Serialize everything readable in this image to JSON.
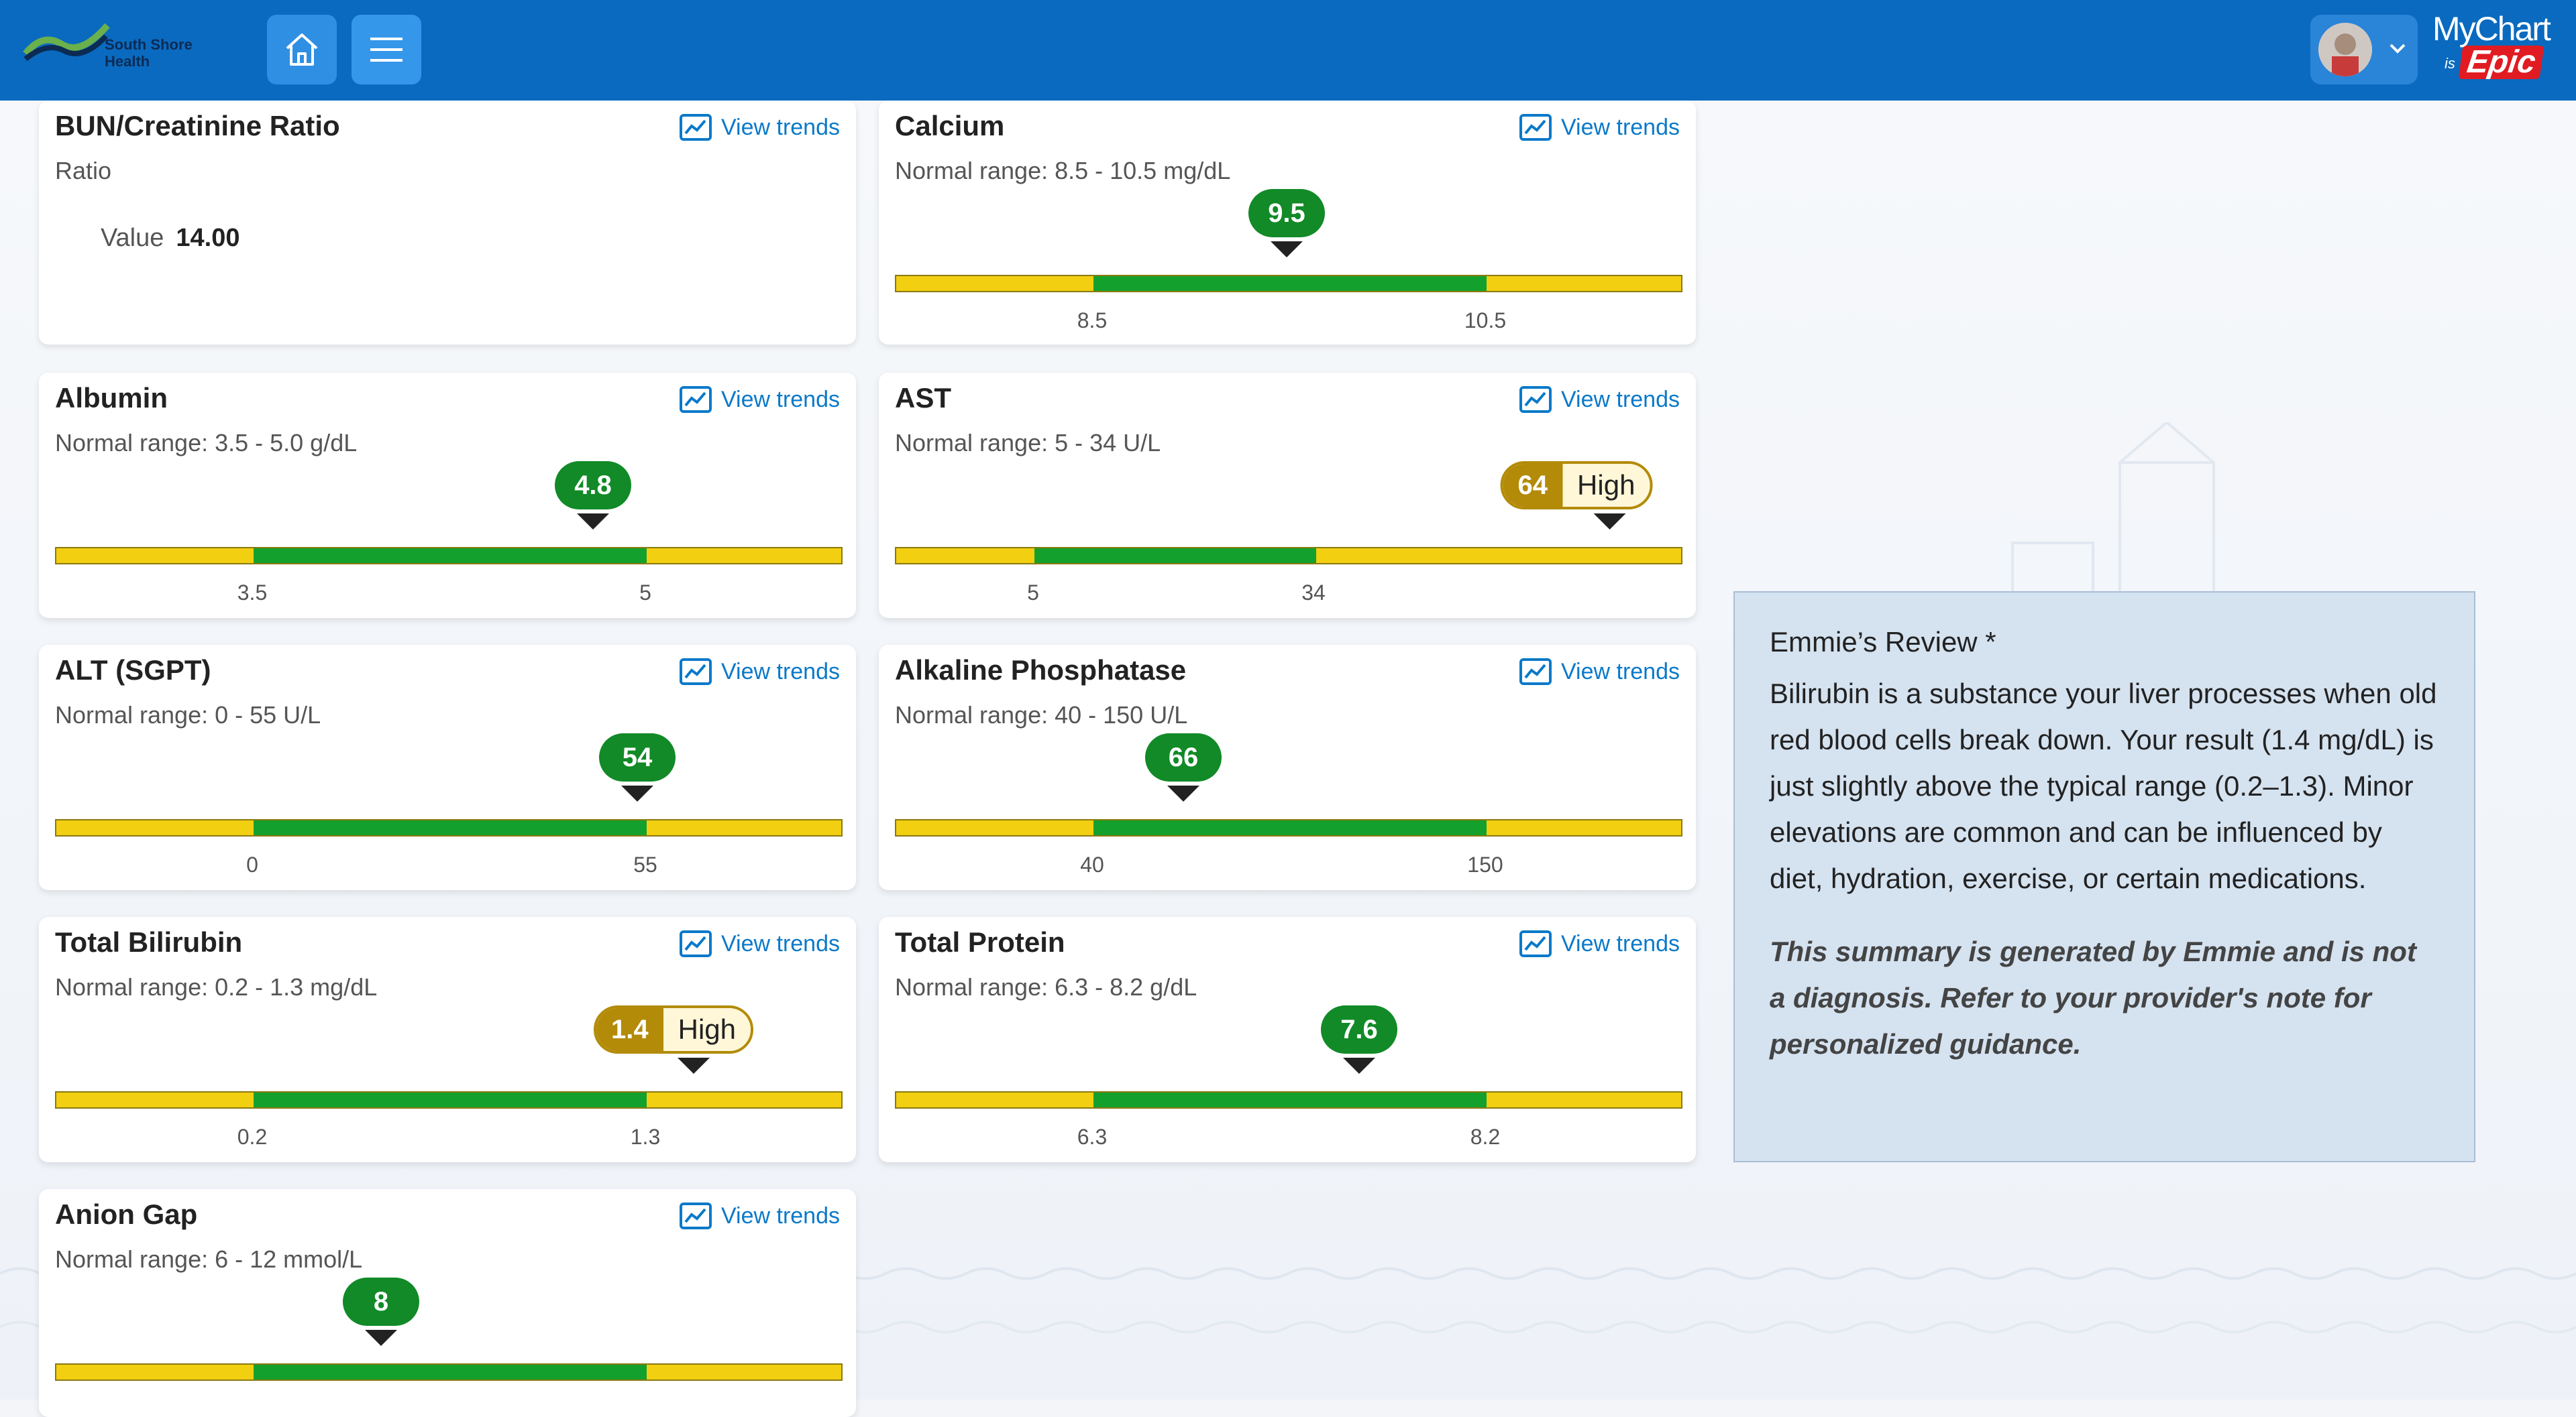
{
  "header": {
    "logo_text": [
      "South Shore",
      "Health"
    ],
    "brand": {
      "mychart": "MyChart",
      "is": "is",
      "epic": "Epic"
    }
  },
  "cards": [
    {
      "title": "BUN/Creatinine Ratio",
      "subtitle": "Ratio",
      "value_label": "Value",
      "value": "14.00",
      "trends": "View trends"
    },
    {
      "title": "Calcium",
      "subtitle": "Normal range: 8.5 - 10.5 mg/dL",
      "trends": "View trends",
      "result": "9.5",
      "low_label": "8.5",
      "high_label": "10.5"
    },
    {
      "title": "Albumin",
      "subtitle": "Normal range: 3.5 - 5.0 g/dL",
      "trends": "View trends",
      "result": "4.8",
      "low_label": "3.5",
      "high_label": "5"
    },
    {
      "title": "AST",
      "subtitle": "Normal range: 5 - 34 U/L",
      "trends": "View trends",
      "result": "64",
      "flag": "High",
      "low_label": "5",
      "high_label": "34"
    },
    {
      "title": "ALT (SGPT)",
      "subtitle": "Normal range: 0 - 55 U/L",
      "trends": "View trends",
      "result": "54",
      "low_label": "0",
      "high_label": "55"
    },
    {
      "title": "Alkaline Phosphatase",
      "subtitle": "Normal range: 40 - 150 U/L",
      "trends": "View trends",
      "result": "66",
      "low_label": "40",
      "high_label": "150"
    },
    {
      "title": "Total Bilirubin",
      "subtitle": "Normal range: 0.2 - 1.3 mg/dL",
      "trends": "View trends",
      "result": "1.4",
      "flag": "High",
      "low_label": "0.2",
      "high_label": "1.3"
    },
    {
      "title": "Total Protein",
      "subtitle": "Normal range: 6.3 - 8.2 g/dL",
      "trends": "View trends",
      "result": "7.6",
      "low_label": "6.3",
      "high_label": "8.2"
    },
    {
      "title": "Anion Gap",
      "subtitle": "Normal range: 6 - 12 mmol/L",
      "trends": "View trends",
      "result": "8"
    }
  ],
  "review": {
    "title": "Emmie’s Review *",
    "body": "Bilirubin is a substance your liver processes when old red blood cells break down. Your result (1.4 mg/dL) is just slightly above the typical range (0.2–1.3). Minor elevations are common and can be influenced by diet, hydration, exercise, or certain medications.",
    "note": "This summary is generated by Emmie and is not a diagnosis. Refer to your provider's note for personalized guidance."
  },
  "colors": {
    "header": "#0a6abf",
    "in_range": "#14a02c",
    "out_of_range": "#f3cf12",
    "result_normal": "#118a27",
    "result_high": "#b38b08",
    "link": "#0a79c9"
  }
}
